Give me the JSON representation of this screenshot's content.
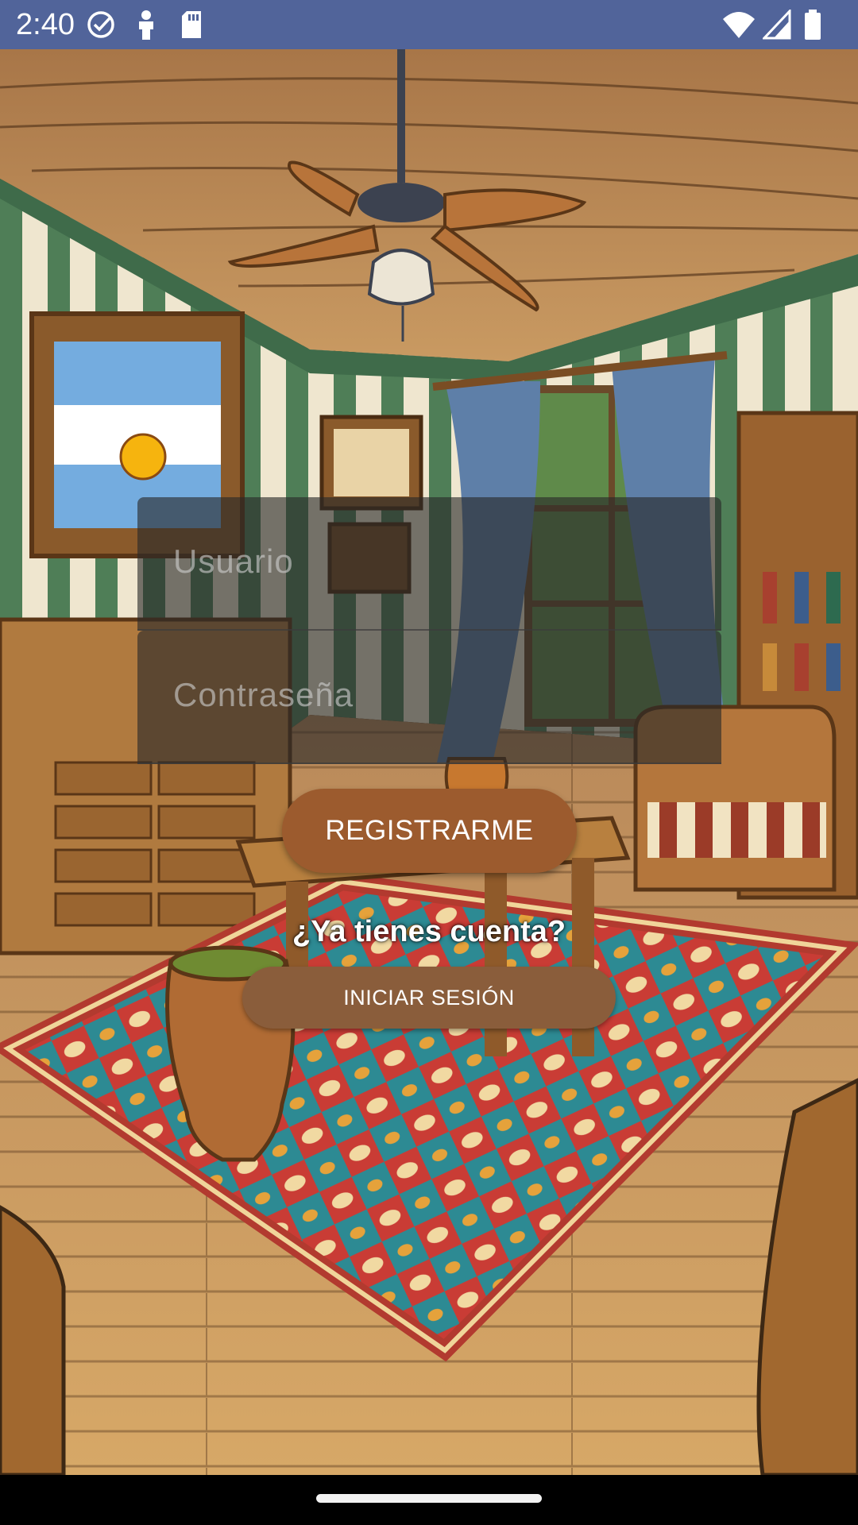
{
  "status_bar": {
    "time": "2:40",
    "left_icons": [
      "check-circle-icon",
      "person-icon",
      "sd-card-icon"
    ],
    "right_icons": [
      "wifi-icon",
      "signal-icon",
      "battery-icon"
    ]
  },
  "background": {
    "icon": "argentine-living-room-illustration"
  },
  "form": {
    "username_placeholder": "Usuario",
    "password_placeholder": "Contraseña",
    "register_label": "REGISTRARME",
    "account_question": "¿Ya tienes cuenta?",
    "login_label": "INICIAR SESIÓN"
  },
  "colors": {
    "status_bar": "#51649a",
    "register_button": "#9c5b2e",
    "login_button": "#8a5d3b"
  }
}
